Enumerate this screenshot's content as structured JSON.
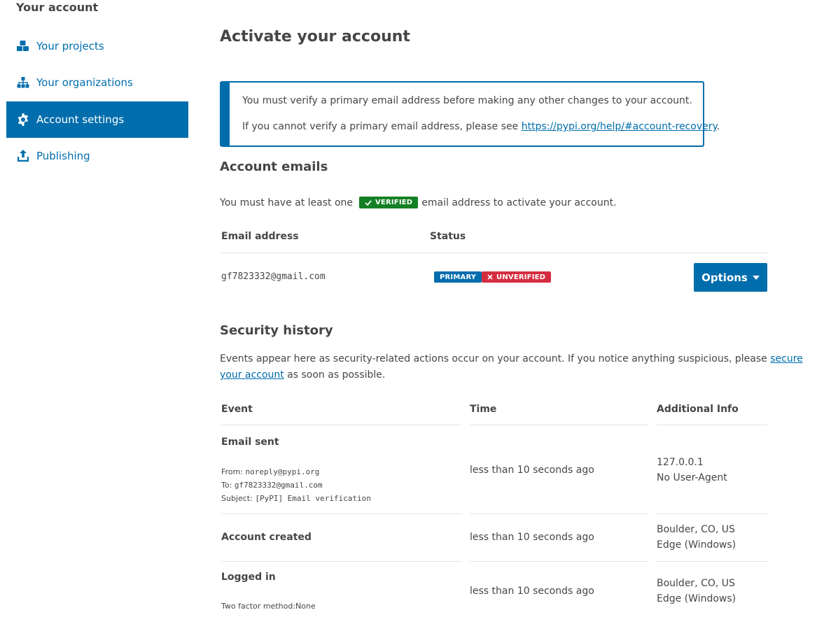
{
  "sidebar": {
    "heading": "Your account",
    "items": [
      {
        "label": "Your projects",
        "icon": "cubes-icon",
        "active": false
      },
      {
        "label": "Your organizations",
        "icon": "sitemap-icon",
        "active": false
      },
      {
        "label": "Account settings",
        "icon": "gear-icon",
        "active": true
      },
      {
        "label": "Publishing",
        "icon": "upload-icon",
        "active": false
      }
    ]
  },
  "main": {
    "title": "Activate your account",
    "notice": {
      "line1": "You must verify a primary email address before making any other changes to your account.",
      "line2_prefix": "If you cannot verify a primary email address, please see ",
      "line2_link": "https://pypi.org/help/#account-recovery",
      "line2_suffix": "."
    },
    "emails": {
      "heading": "Account emails",
      "intro_prefix": "You must have at least one",
      "verified_badge": "VERIFIED",
      "intro_suffix": "email address to activate your account.",
      "columns": {
        "email": "Email address",
        "status": "Status"
      },
      "rows": [
        {
          "email": "gf7823332@gmail.com",
          "badge_primary": "PRIMARY",
          "badge_unverified": "UNVERIFIED",
          "options_label": "Options"
        }
      ]
    },
    "security": {
      "heading": "Security history",
      "intro_prefix": "Events appear here as security-related actions occur on your account. If you notice anything suspicious, please",
      "intro_link_1": "secure",
      "intro_link_2": "your account",
      "intro_suffix": "as soon as possible.",
      "columns": {
        "event": "Event",
        "time": "Time",
        "info": "Additional Info"
      },
      "rows": [
        {
          "event": "Email sent",
          "from_label": "From:",
          "from_value": "noreply@pypi.org",
          "to_label": "To:",
          "to_value": "gf7823332@gmail.com",
          "subject_label": "Subject:",
          "subject_value": "[PyPI] Email verification",
          "time": "less than 10 seconds ago",
          "info_1": "127.0.0.1",
          "info_2": "No User-Agent"
        },
        {
          "event": "Account created",
          "time": "less than 10 seconds ago",
          "info_1": "Boulder, CO, US",
          "info_2": "Edge (Windows)"
        },
        {
          "event": "Logged in",
          "detail": "Two factor method:None",
          "time": "less than 10 seconds ago",
          "info_1": "Boulder, CO, US",
          "info_2": "Edge (Windows)"
        }
      ]
    }
  },
  "colors": {
    "accent": "#006dad",
    "verified": "#148024",
    "unverified": "#d52d40",
    "text": "#464646"
  }
}
